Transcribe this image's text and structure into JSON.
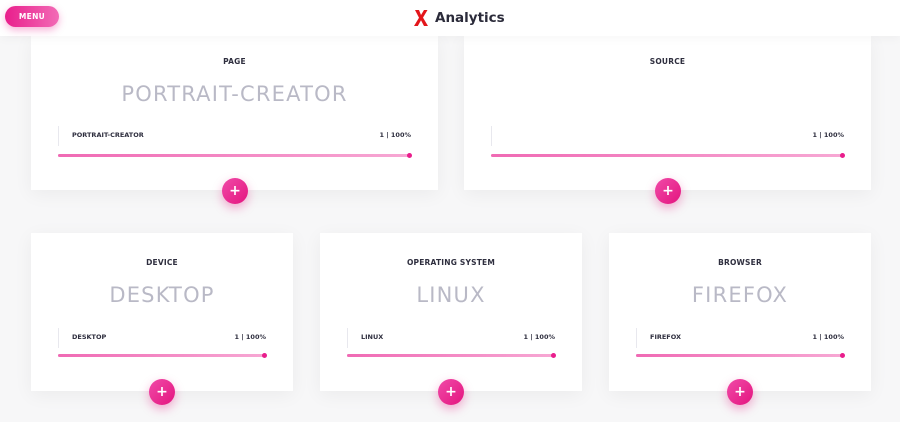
{
  "header": {
    "menu_label": "MENU",
    "title": "Analytics",
    "logo_icon": "x-logo-icon"
  },
  "colors": {
    "accent": "#e91e8c",
    "bar": "#f06ab4",
    "track": "#f6d3e7",
    "value_text": "#b9b9c6"
  },
  "cards": {
    "page": {
      "label": "PAGE",
      "value": "PORTRAIT-CREATOR",
      "row_name": "PORTRAIT-CREATOR",
      "row_stat": "1 | 100%",
      "percent": 100,
      "add_label": "+"
    },
    "source": {
      "label": "SOURCE",
      "value": "",
      "row_name": "",
      "row_stat": "1 | 100%",
      "percent": 100,
      "add_label": "+"
    },
    "device": {
      "label": "DEVICE",
      "value": "DESKTOP",
      "row_name": "DESKTOP",
      "row_stat": "1 | 100%",
      "percent": 100,
      "add_label": "+"
    },
    "os": {
      "label": "OPERATING SYSTEM",
      "value": "LINUX",
      "row_name": "LINUX",
      "row_stat": "1 | 100%",
      "percent": 100,
      "add_label": "+"
    },
    "browser": {
      "label": "BROWSER",
      "value": "FIREFOX",
      "row_name": "FIREFOX",
      "row_stat": "1 | 100%",
      "percent": 100,
      "add_label": "+"
    }
  }
}
